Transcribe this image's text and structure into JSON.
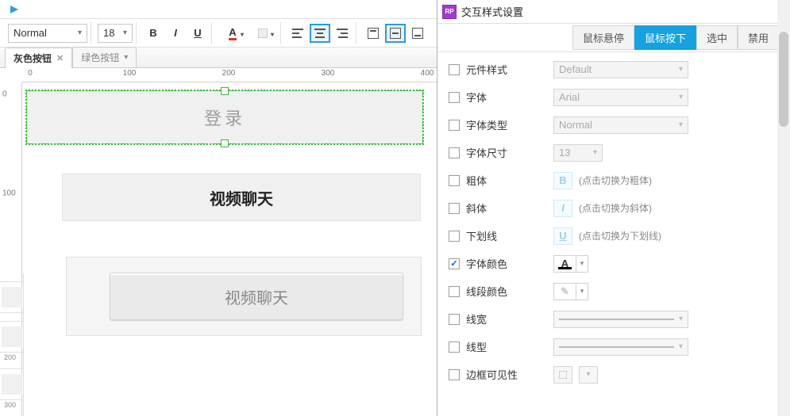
{
  "toolbar": {
    "style_select": "Normal",
    "font_size": "18"
  },
  "tabs": {
    "items": [
      {
        "label": "灰色按钮",
        "active": true
      },
      {
        "label": "绿色按钮",
        "active": false
      }
    ]
  },
  "ruler": {
    "h": [
      "0",
      "100",
      "200",
      "300",
      "400"
    ],
    "v": [
      "0",
      "100",
      "200",
      "300"
    ]
  },
  "canvas": {
    "w1_text": "登录",
    "w2_text": "视频聊天",
    "w3_text": "视频聊天"
  },
  "panel": {
    "title": "交互样式设置",
    "rp": "RP",
    "states": [
      {
        "label": "鼠标悬停",
        "active": false
      },
      {
        "label": "鼠标按下",
        "active": true
      },
      {
        "label": "选中",
        "active": false
      },
      {
        "label": "禁用",
        "active": false
      }
    ],
    "rows": {
      "element_style": {
        "label": "元件样式",
        "value": "Default",
        "checked": false
      },
      "font": {
        "label": "字体",
        "value": "Arial",
        "checked": false
      },
      "font_type": {
        "label": "字体类型",
        "value": "Normal",
        "checked": false
      },
      "font_size": {
        "label": "字体尺寸",
        "value": "13",
        "checked": false
      },
      "bold": {
        "label": "粗体",
        "btn": "B",
        "hint": "(点击切换为粗体)",
        "checked": false
      },
      "italic": {
        "label": "斜体",
        "btn": "I",
        "hint": "(点击切换为斜体)",
        "checked": false
      },
      "underline": {
        "label": "下划线",
        "btn": "U",
        "hint": "(点击切换为下划线)",
        "checked": false
      },
      "font_color": {
        "label": "字体颜色",
        "checked": true
      },
      "line_color": {
        "label": "线段颜色",
        "checked": false
      },
      "line_width": {
        "label": "线宽",
        "checked": false
      },
      "line_style": {
        "label": "线型",
        "checked": false
      },
      "border_vis": {
        "label": "边框可见性",
        "checked": false
      }
    },
    "glyphs": {
      "A": "A",
      "pencil": "✎"
    }
  }
}
